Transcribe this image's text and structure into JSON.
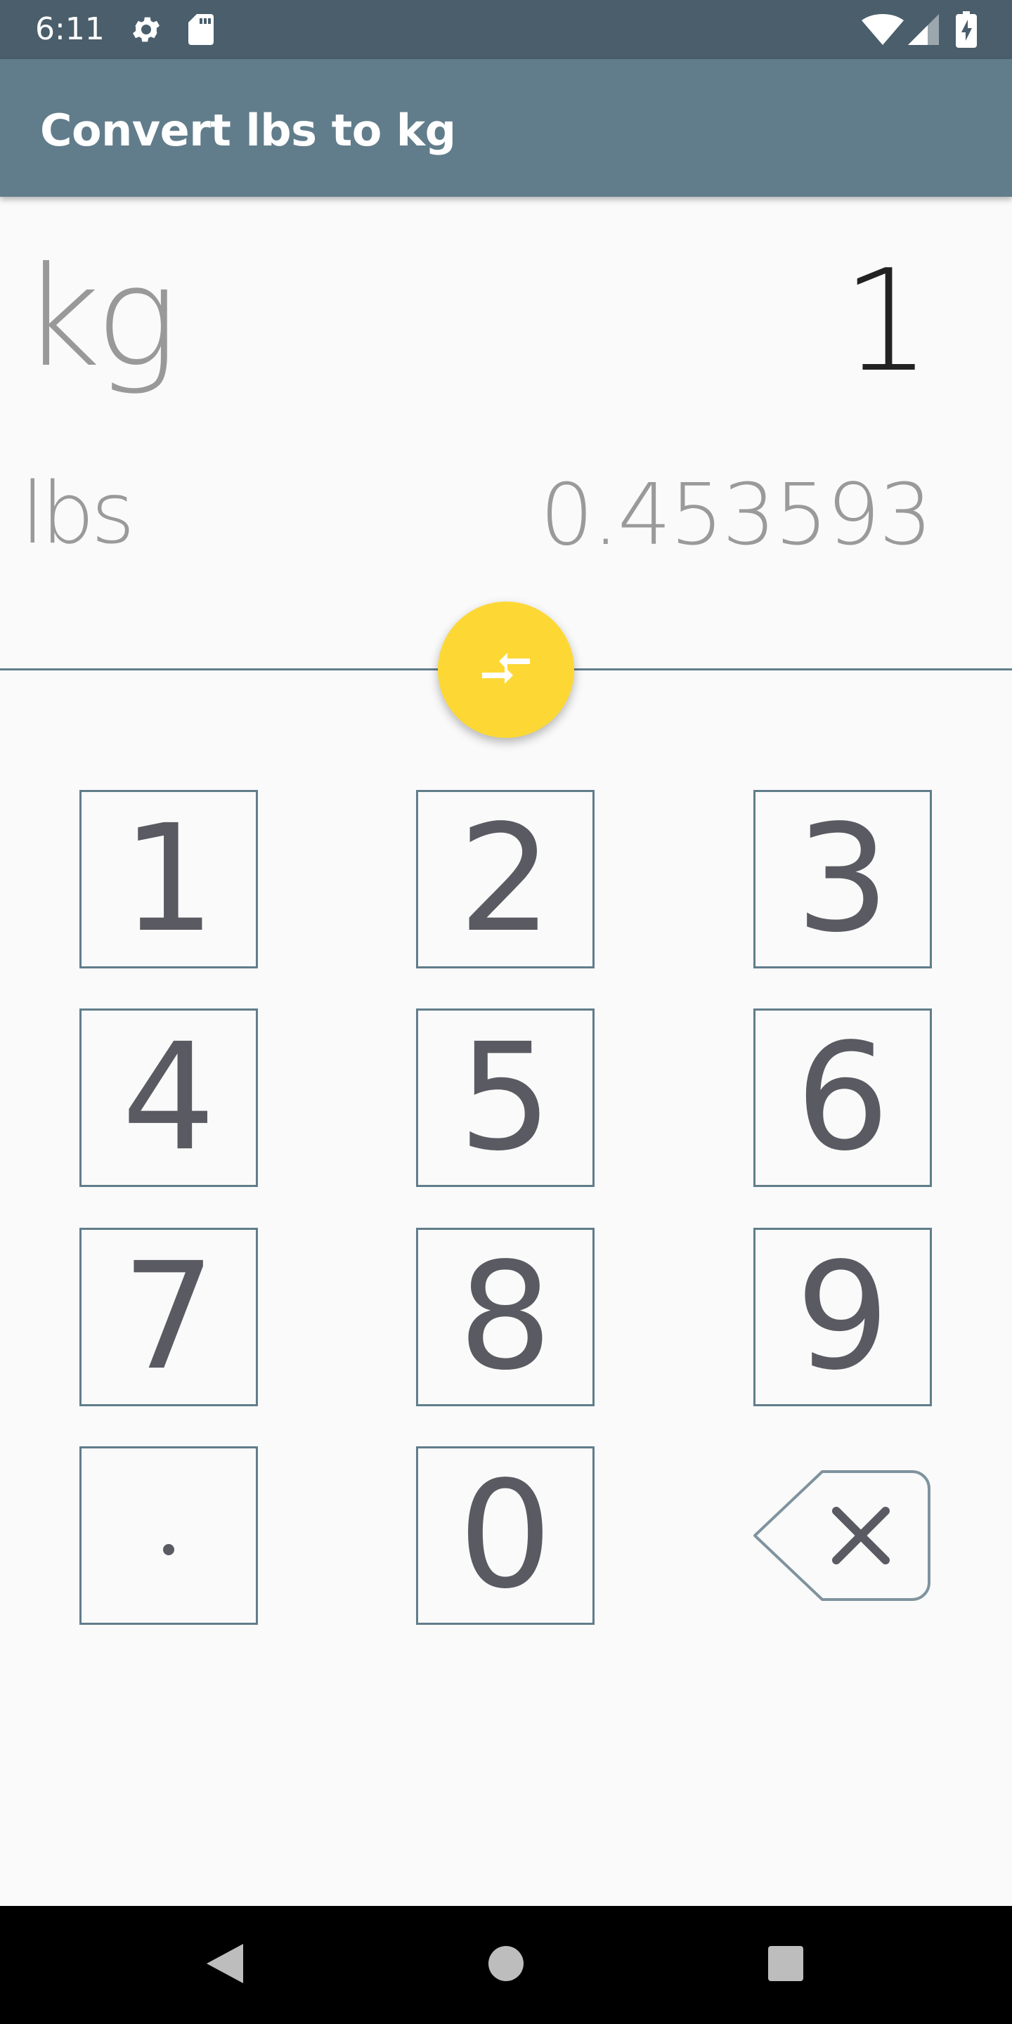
{
  "status_bar": {
    "time": "6:11",
    "icons": [
      "settings-icon",
      "sd-card-icon",
      "wifi-icon",
      "cell-signal-icon",
      "battery-charging-icon"
    ]
  },
  "app_bar": {
    "title": "Convert lbs to kg"
  },
  "conversion": {
    "primary_unit": "kg",
    "primary_value": "1",
    "secondary_unit": "lbs",
    "secondary_value": "0.453593"
  },
  "swap_button": {
    "icon": "swap-arrows-icon",
    "color": "#fdd835"
  },
  "keypad": {
    "keys": [
      "1",
      "2",
      "3",
      "4",
      "5",
      "6",
      "7",
      "8",
      "9",
      ".",
      "0"
    ],
    "backspace_icon": "backspace-icon"
  },
  "navigation": {
    "icons": [
      "back-icon",
      "home-icon",
      "recents-icon"
    ]
  },
  "colors": {
    "status_bar": "#4a5e6b",
    "app_bar": "#617d8b",
    "accent": "#fdd835",
    "key_border": "#617d8b",
    "key_text": "#5a5a62"
  }
}
